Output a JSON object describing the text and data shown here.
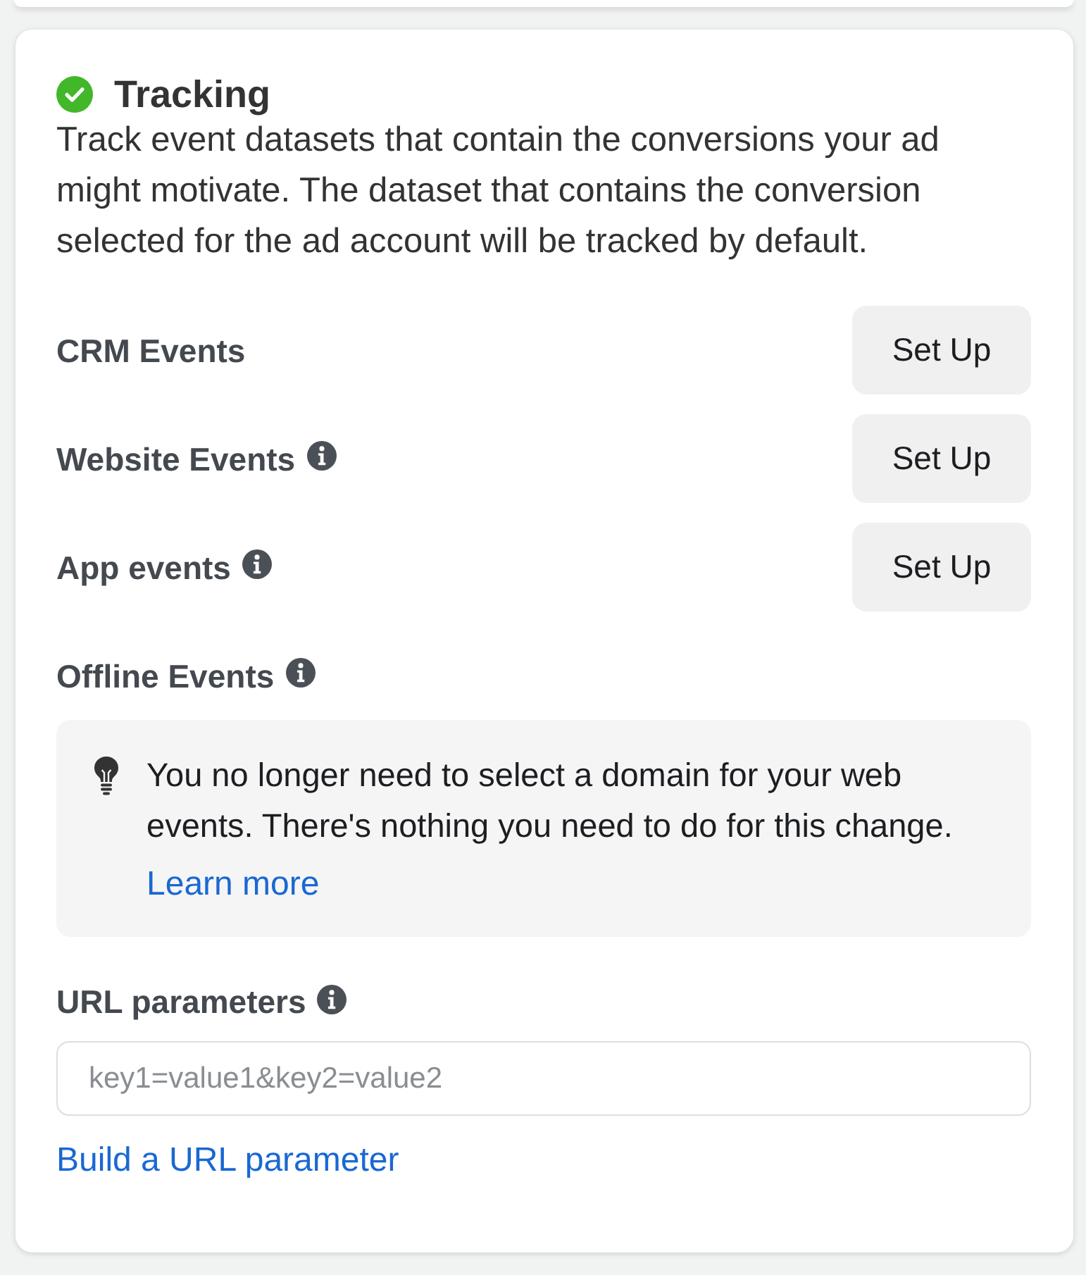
{
  "section": {
    "title": "Tracking",
    "complete": true,
    "description": "Track event datasets that contain the conversions your ad might motivate. The dataset that contains the conversion selected for the ad account will be tracked by default."
  },
  "event_rows": [
    {
      "label": "CRM Events",
      "info": false,
      "button": "Set Up"
    },
    {
      "label": "Website Events",
      "info": true,
      "button": "Set Up"
    },
    {
      "label": "App events",
      "info": true,
      "button": "Set Up"
    },
    {
      "label": "Offline Events",
      "info": true
    }
  ],
  "notice": {
    "text": "You no longer need to select a domain for your web events. There's nothing you need to do for this change.",
    "link": "Learn more"
  },
  "url_parameters": {
    "label": "URL parameters",
    "info": true,
    "placeholder": "key1=value1&key2=value2",
    "link": "Build a URL parameter"
  }
}
